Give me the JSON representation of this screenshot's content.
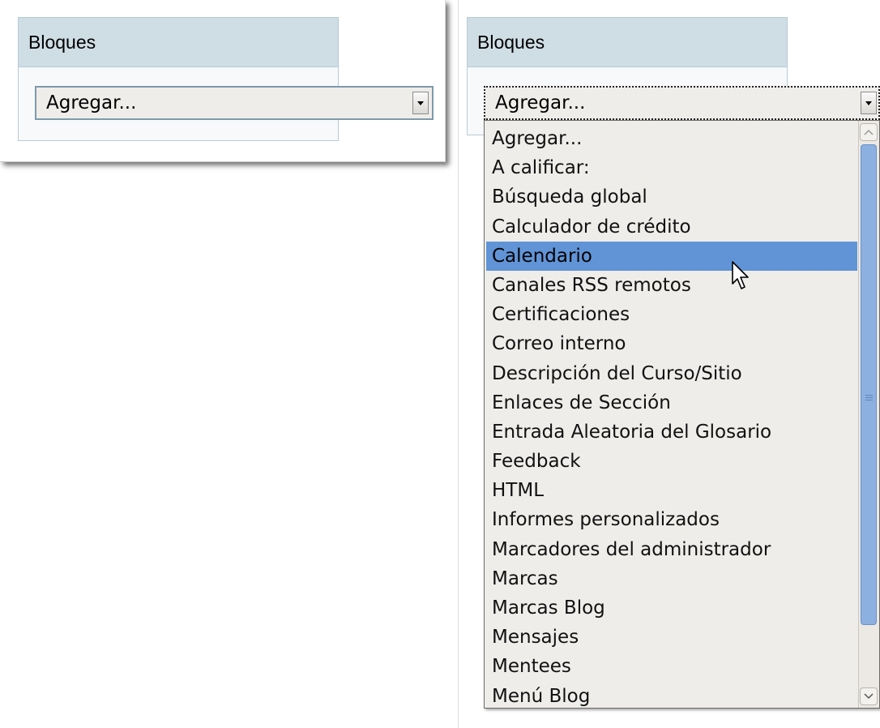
{
  "left_panel": {
    "block_title": "Bloques",
    "select_value": "Agregar..."
  },
  "right_panel": {
    "block_title": "Bloques",
    "select_value": "Agregar...",
    "dropdown": {
      "highlighted_index": 4,
      "options": [
        "Agregar...",
        "A calificar:",
        "Búsqueda global",
        "Calculador de crédito",
        "Calendario",
        "Canales RSS remotos",
        "Certificaciones",
        "Correo interno",
        "Descripción del Curso/Sitio",
        "Enlaces de Sección",
        "Entrada Aleatoria del Glosario",
        "Feedback",
        "HTML",
        "Informes personalizados",
        "Marcadores del administrador",
        "Marcas",
        "Marcas Blog",
        "Mensajes",
        "Mentees",
        "Menú Blog"
      ]
    }
  },
  "icons": {
    "select_arrow": "chevron-down-icon",
    "scroll_up": "scroll-up-icon",
    "scroll_down": "scroll-down-icon",
    "pointer": "mouse-pointer-icon"
  },
  "colors": {
    "block_header": "#cfdde5",
    "block_border": "#b7cbd6",
    "highlight": "#6194d6",
    "scroll_thumb": "#8cb0e0"
  }
}
